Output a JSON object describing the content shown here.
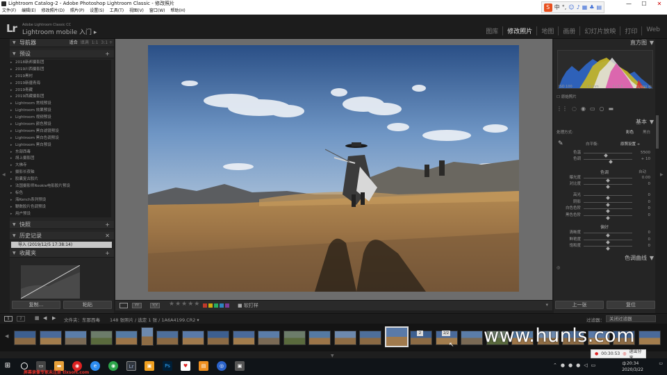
{
  "window": {
    "title": "Lightroom Catalog-2 - Adobe Photoshop Lightroom Classic - 修改照片",
    "controls": [
      "—",
      "☐",
      "✕"
    ],
    "menu": [
      "文件(F)",
      "编辑(E)",
      "修改照片(D)",
      "照片(P)",
      "设置(S)",
      "工具(T)",
      "视图(V)",
      "窗口(W)",
      "帮助(H)"
    ],
    "ime": {
      "logo": "S",
      "lang": "中",
      "punct": "°,"
    }
  },
  "identity": {
    "logo": "Lr",
    "line1": "Adobe Lightroom Classic CC",
    "line2": "Lightroom mobile 入门 ▸"
  },
  "modules": [
    {
      "label": "图库",
      "active": false
    },
    {
      "label": "修改照片",
      "active": true
    },
    {
      "label": "地图",
      "active": false
    },
    {
      "label": "画册",
      "active": false
    },
    {
      "label": "幻灯片放映",
      "active": false
    },
    {
      "label": "打印",
      "active": false
    },
    {
      "label": "Web",
      "active": false
    }
  ],
  "left": {
    "navigator": "导航器",
    "nav_opts": [
      "适合",
      "填满",
      "1:1",
      "3:1 ÷"
    ],
    "presets": "预设",
    "preset_items": [
      "2018新邦摄影团",
      "2019川西摄影团",
      "2019黑村",
      "2019新疆青海",
      "2019青藏",
      "2019西藏摄影团",
      "Lightroom 常规预设",
      "Lightroom 效果预设",
      "Lightroom 视频预设",
      "Lightroom 颜色预设",
      "Lightroom 黑白滤镜预设",
      "Lightroom 黑白色调预设",
      "Lightroom 黑白预设",
      "东部西毒",
      "胡上摄影团",
      "大佛寺",
      "摄影长夜轴",
      "胶囊复古胶片",
      "法国摄影师Rookie电影胶片预设",
      "标色",
      "海Kench系列预设",
      "鞭数胶片色调预设",
      "用户预设"
    ],
    "snapshots": "快照",
    "history": "历史记录",
    "history_item": "导入 (2019/12/5 17:38:14)",
    "collections": "收藏夹",
    "copy_btn": "复制...",
    "paste_btn": "粘贴"
  },
  "toolbar": {
    "stars": "★★★★★",
    "flag_label": "■ 软打样",
    "flag_colors": [
      "#c0392b",
      "#d4ac0d",
      "#27ae60",
      "#2e86c1",
      "#7d3c98"
    ]
  },
  "right": {
    "histogram": "直方图",
    "hist_meta": [
      "ISO 100",
      "14 mm",
      "f / 5.6",
      "1/400 秒"
    ],
    "orig_photo": "原始照片",
    "basic": "基本",
    "treatment": "处理方式:",
    "color": "彩色",
    "bw": "黑白",
    "wb_label": "白平衡:",
    "wb_value": "原照设置 ÷",
    "rows_wb": [
      {
        "label": "色温",
        "value": "5500",
        "pos": 0.45
      },
      {
        "label": "色调",
        "value": "+ 10",
        "pos": 0.55
      }
    ],
    "tone": "色调",
    "tone_auto": "自动",
    "rows_tone1": [
      {
        "label": "曝光度",
        "value": "0.00",
        "pos": 0.5
      },
      {
        "label": "对比度",
        "value": "0",
        "pos": 0.5
      }
    ],
    "rows_tone2": [
      {
        "label": "高光",
        "value": "0",
        "pos": 0.5
      },
      {
        "label": "阴影",
        "value": "0",
        "pos": 0.5
      },
      {
        "label": "白色色阶",
        "value": "0",
        "pos": 0.5
      },
      {
        "label": "黑色色阶",
        "value": "0",
        "pos": 0.5
      }
    ],
    "presence": "偏好",
    "rows_presence": [
      {
        "label": "清晰度",
        "value": "0",
        "pos": 0.5
      },
      {
        "label": "鲜艳度",
        "value": "0",
        "pos": 0.5
      },
      {
        "label": "饱和度",
        "value": "0",
        "pos": 0.5
      }
    ],
    "tone_curve": "色调曲线",
    "prev_btn": "上一张",
    "reset_btn": "复位"
  },
  "filmbar": {
    "pages": [
      "1",
      "2"
    ],
    "source": "文件夹：东那西毒",
    "count": "148 张照片 / 选定 1 张 / 1A6A4199.CR2 ▾",
    "filter_label": "过滤器：",
    "filter_value": "关闭过滤器"
  },
  "filmstrip": {
    "badges": [
      "2",
      "2/2"
    ]
  },
  "watermark": "www.hunls.com",
  "red_watermark": "屏幕录像专家未注册 tlxsoft.com",
  "recorder": {
    "time": "00:30:53",
    "exit": "退出分享"
  },
  "clock": {
    "time": "20:34",
    "date": "2020/3/22"
  },
  "tray_lang": "中"
}
